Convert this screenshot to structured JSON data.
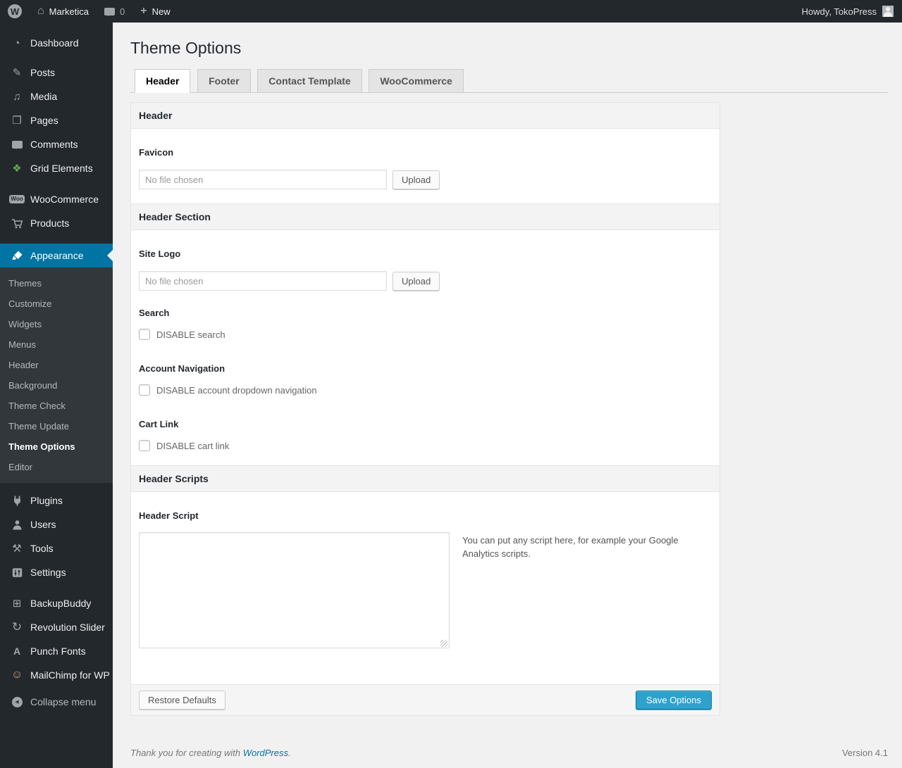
{
  "admin_bar": {
    "site_name": "Marketica",
    "comments_count": "0",
    "new_label": "New",
    "howdy": "Howdy, TokoPress"
  },
  "sidebar": {
    "items": [
      {
        "label": "Dashboard",
        "icon": "dashboard-icon"
      },
      {
        "label": "Posts",
        "icon": "posts-icon"
      },
      {
        "label": "Media",
        "icon": "media-icon"
      },
      {
        "label": "Pages",
        "icon": "pages-icon"
      },
      {
        "label": "Comments",
        "icon": "comments-icon"
      },
      {
        "label": "Grid Elements",
        "icon": "grid-elements-icon"
      },
      {
        "label": "WooCommerce",
        "icon": "woocommerce-icon"
      },
      {
        "label": "Products",
        "icon": "products-icon"
      },
      {
        "label": "Appearance",
        "icon": "appearance-icon",
        "active": true
      },
      {
        "label": "Plugins",
        "icon": "plugins-icon"
      },
      {
        "label": "Users",
        "icon": "users-icon"
      },
      {
        "label": "Tools",
        "icon": "tools-icon"
      },
      {
        "label": "Settings",
        "icon": "settings-icon"
      },
      {
        "label": "BackupBuddy",
        "icon": "backupbuddy-icon"
      },
      {
        "label": "Revolution Slider",
        "icon": "revolution-slider-icon"
      },
      {
        "label": "Punch Fonts",
        "icon": "punch-fonts-icon"
      },
      {
        "label": "MailChimp for WP",
        "icon": "mailchimp-icon"
      },
      {
        "label": "Collapse menu",
        "icon": "collapse-icon"
      }
    ],
    "appearance_submenu": [
      {
        "label": "Themes"
      },
      {
        "label": "Customize"
      },
      {
        "label": "Widgets"
      },
      {
        "label": "Menus"
      },
      {
        "label": "Header"
      },
      {
        "label": "Background"
      },
      {
        "label": "Theme Check"
      },
      {
        "label": "Theme Update"
      },
      {
        "label": "Theme Options",
        "current": true
      },
      {
        "label": "Editor"
      }
    ]
  },
  "page": {
    "title": "Theme Options",
    "tabs": [
      {
        "label": "Header",
        "active": true
      },
      {
        "label": "Footer",
        "active": false
      },
      {
        "label": "Contact Template",
        "active": false
      },
      {
        "label": "WooCommerce",
        "active": false
      }
    ]
  },
  "panel": {
    "header": {
      "title": "Header",
      "favicon_label": "Favicon",
      "favicon_placeholder": "No file chosen",
      "favicon_value": "",
      "upload_label": "Upload"
    },
    "header_section": {
      "title": "Header Section",
      "site_logo_label": "Site Logo",
      "site_logo_placeholder": "No file chosen",
      "site_logo_value": "",
      "upload_label": "Upload",
      "search_label": "Search",
      "disable_search_label": "DISABLE search",
      "disable_search_checked": false,
      "account_nav_label": "Account Navigation",
      "disable_account_label": "DISABLE account dropdown navigation",
      "disable_account_checked": false,
      "cart_link_label": "Cart Link",
      "disable_cart_label": "DISABLE cart link",
      "disable_cart_checked": false
    },
    "header_scripts": {
      "title": "Header Scripts",
      "script_label": "Header Script",
      "script_value": "",
      "hint": "You can put any script here, for example your Google Analytics scripts."
    },
    "footer": {
      "restore_label": "Restore Defaults",
      "save_label": "Save Options"
    }
  },
  "footer": {
    "thanks_prefix": "Thank you for creating with ",
    "wordpress_link": "WordPress",
    "thanks_suffix": ".",
    "version": "Version 4.1"
  },
  "colors": {
    "admin_bar_bg": "#23282d",
    "menu_bg": "#23282d",
    "submenu_bg": "#32373c",
    "menu_highlight": "#0074a2",
    "primary_button_bg": "#2ea2cc",
    "primary_button_border": "#0074a2",
    "link": "#0074a2",
    "page_bg": "#f1f1f1",
    "panel_bg": "#ffffff",
    "section_bar_bg": "#f3f3f3"
  },
  "icons": {
    "wordpress-logo-icon": "W",
    "site-home-icon": "⌂",
    "comments-bubble-icon": "speech-bubble-shape",
    "plus-icon": "+",
    "dashboard-icon": "◔",
    "posts-icon": "✎",
    "media-icon": "♫",
    "pages-icon": "❐",
    "comments-icon": "speech-bubble-shape",
    "grid-elements-icon": "❖",
    "woocommerce-icon": "Woo-badge",
    "products-icon": "cart-svg",
    "appearance-icon": "brush-svg",
    "plugins-icon": "plug-svg",
    "users-icon": "person-svg",
    "tools-icon": "⚒",
    "settings-icon": "sliders-svg",
    "backupbuddy-icon": "⊞",
    "revolution-slider-icon": "↻",
    "punch-fonts-icon": "A",
    "mailchimp-icon": "☺",
    "collapse-icon": "◀",
    "user-avatar-icon": "person-silhouette"
  }
}
